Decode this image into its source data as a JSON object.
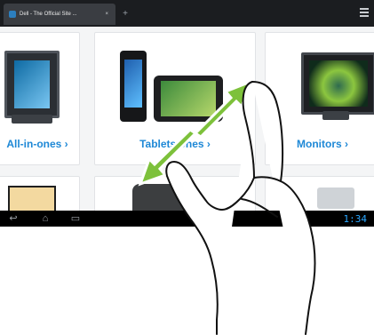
{
  "browser": {
    "tab_title": "Dell - The Official Site ...",
    "close_glyph": "×",
    "new_tab_glyph": "+",
    "time": "1:34"
  },
  "products": [
    {
      "label": "All-in-ones ›"
    },
    {
      "label": "Tablets  ones ›"
    },
    {
      "label": "Monitors ›"
    }
  ],
  "icons": {
    "back": "back-icon",
    "home": "home-icon",
    "recent": "recent-apps-icon",
    "menu": "menu-icon",
    "gesture": "pinch-zoom-gesture-icon"
  },
  "colors": {
    "accent": "#1e88d6",
    "nav": "#000000",
    "gesture_arrow": "#7dc13b"
  }
}
